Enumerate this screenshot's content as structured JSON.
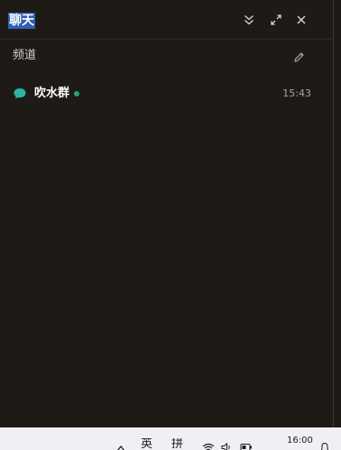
{
  "window": {
    "title": "聊天"
  },
  "header_buttons": [
    {
      "name": "collapse",
      "icon": "double-chevron-down-icon"
    },
    {
      "name": "expand",
      "icon": "expand-icon"
    },
    {
      "name": "close",
      "icon": "close-icon"
    }
  ],
  "channels_section": {
    "title": "频道",
    "edit_icon": "pencil-icon"
  },
  "channels": [
    {
      "name": "吹水群",
      "time": "15:43",
      "icon": "chat-bubble-icon",
      "status": "online",
      "icon_color": "#2bb3a3",
      "status_color": "#22a86a"
    }
  ],
  "taskbar": {
    "ime_lang": "英",
    "ime_mode": "拼",
    "clock_time": "16:00",
    "icons": [
      "chevron-up-icon",
      "wifi-icon",
      "speaker-icon",
      "battery-icon",
      "notification-icon"
    ]
  },
  "colors": {
    "background": "#1e1b17",
    "title_highlight": "#2f5fb3",
    "taskbar": "#eef0f6"
  }
}
